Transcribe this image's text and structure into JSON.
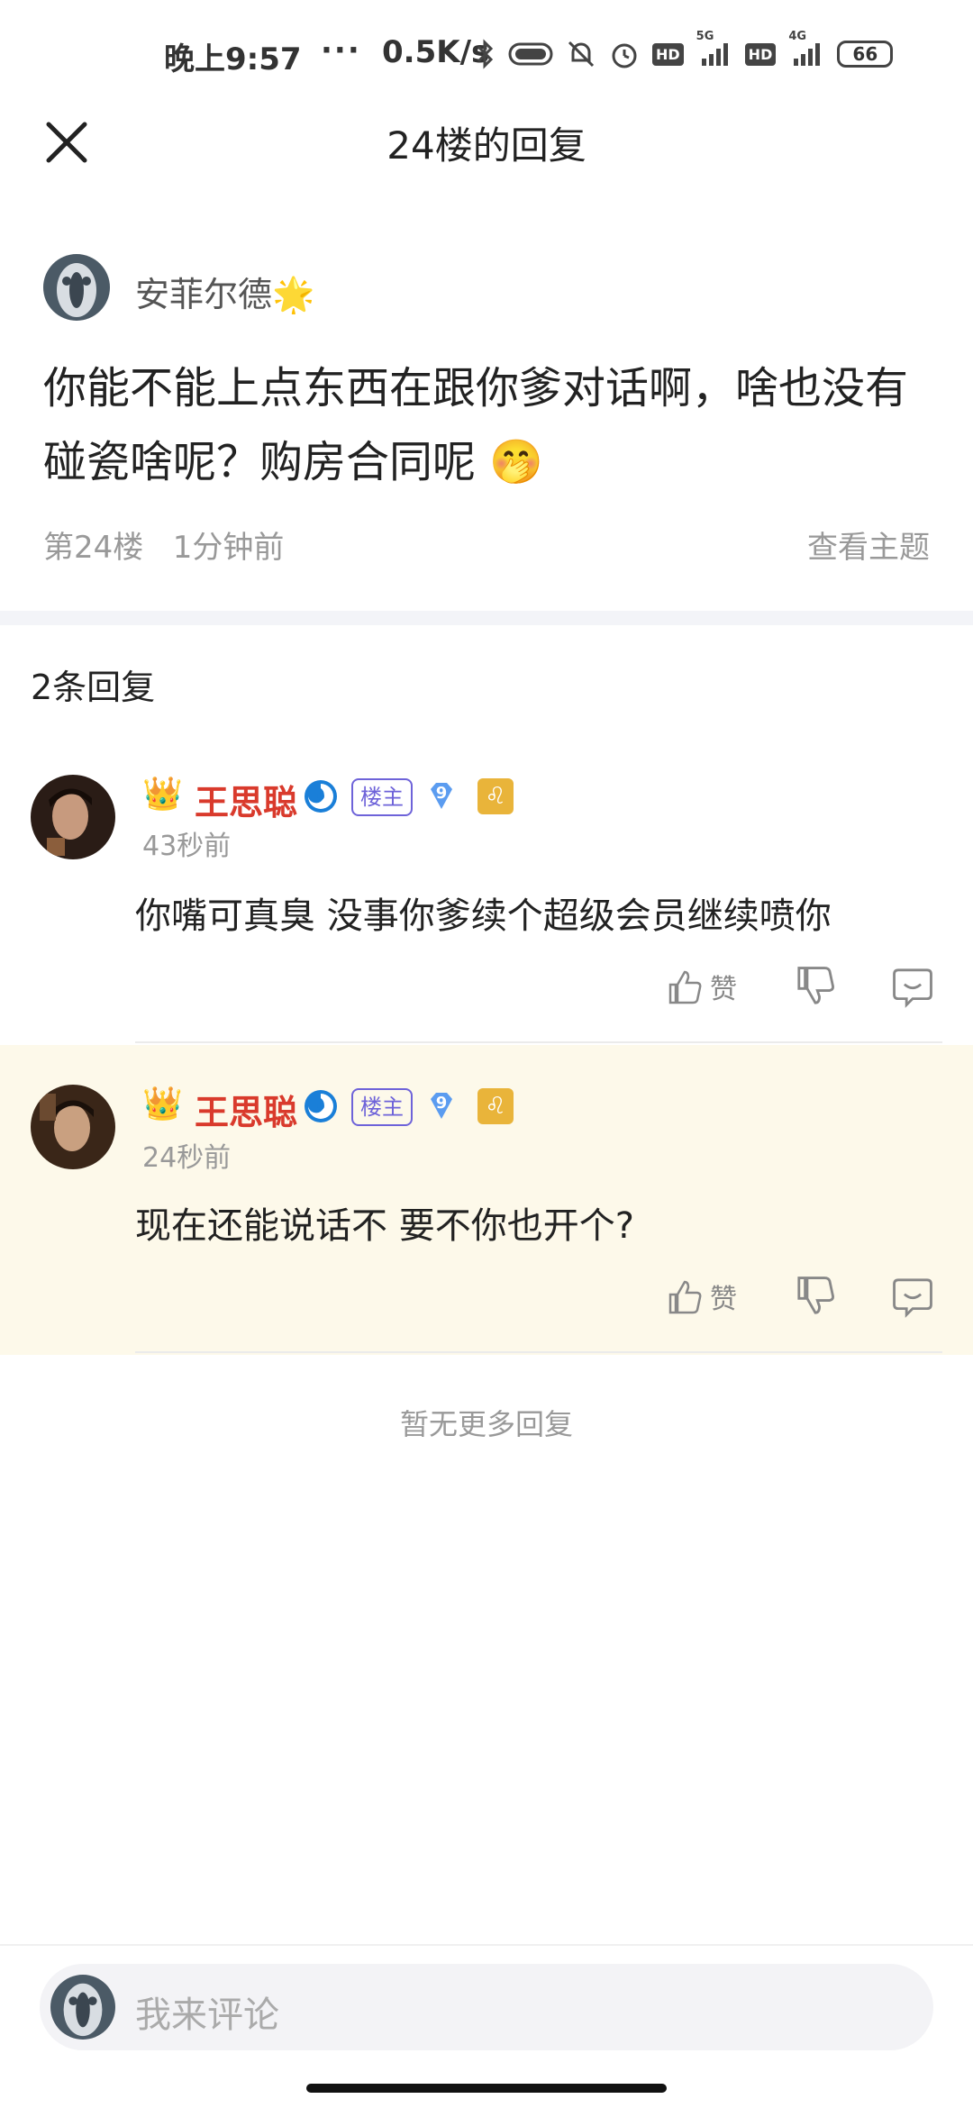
{
  "status_bar": {
    "time": "晚上9:57",
    "dots": "···",
    "net_speed": "0.5K/s",
    "hd1": "HD",
    "signal1": "5G",
    "hd2": "HD",
    "signal2": "4G",
    "battery": "66"
  },
  "header": {
    "title": "24楼的回复",
    "close_icon": "close-icon"
  },
  "original_post": {
    "author": "安菲尔德",
    "author_emoji": "🌟",
    "content": "你能不能上点东西在跟你爹对话啊，啥也没有碰瓷啥呢？购房合同呢",
    "content_emoji": "🤭",
    "floor": "第24楼",
    "time": "1分钟前",
    "view_topic": "查看主题"
  },
  "replies_header": {
    "count_label": "2条回复"
  },
  "replies": [
    {
      "crown": "👑",
      "name": "王思聪",
      "badge_lz": "楼主",
      "level": "9",
      "zodiac": "♌",
      "time": "43秒前",
      "text": "你嘴可真臭 没事你爹续个超级会员继续喷你",
      "like_label": "赞"
    },
    {
      "crown": "👑",
      "name": "王思聪",
      "badge_lz": "楼主",
      "level": "9",
      "zodiac": "♌",
      "time": "24秒前",
      "text": "现在还能说话不 要不你也开个?",
      "like_label": "赞"
    }
  ],
  "footer_note": "暂无更多回复",
  "comment_input": {
    "placeholder": "我来评论"
  },
  "colors": {
    "name_red": "#d93a2c",
    "highlight_bg": "#fdf9ea",
    "badge_purple": "#6e63d9"
  }
}
